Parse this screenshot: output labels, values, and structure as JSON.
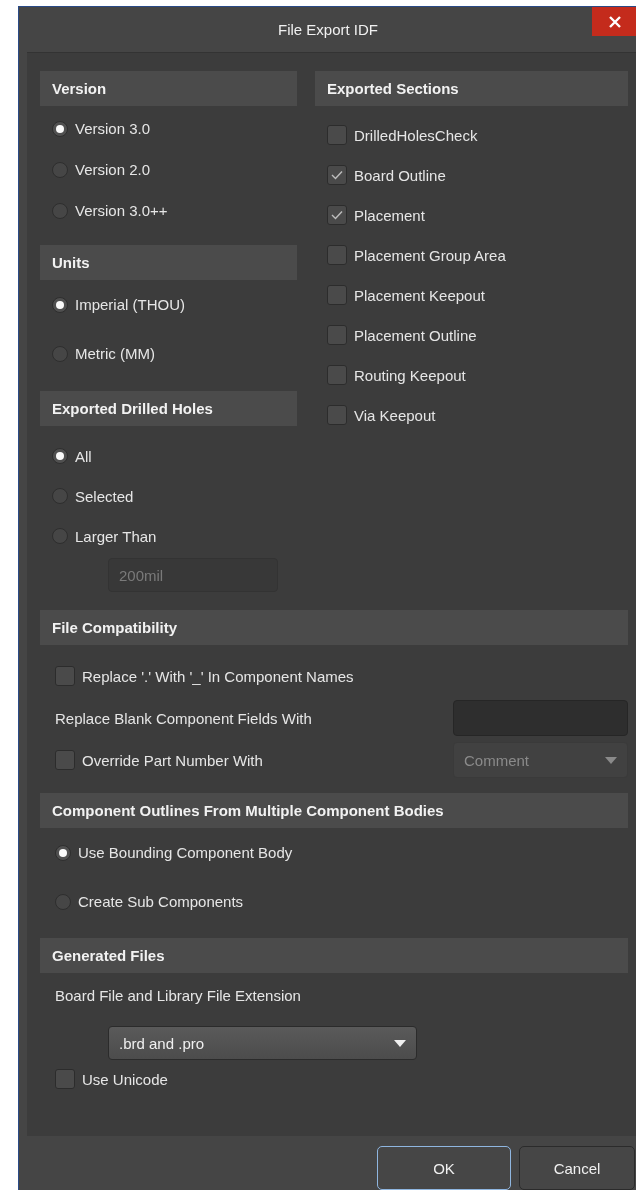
{
  "window": {
    "title": "File Export IDF"
  },
  "version": {
    "title": "Version",
    "options": [
      {
        "label": "Version 3.0",
        "selected": true
      },
      {
        "label": "Version 2.0",
        "selected": false
      },
      {
        "label": "Version 3.0++",
        "selected": false
      }
    ]
  },
  "units": {
    "title": "Units",
    "options": [
      {
        "label": "Imperial (THOU)",
        "selected": true
      },
      {
        "label": "Metric (MM)",
        "selected": false
      }
    ]
  },
  "drilled_holes": {
    "title": "Exported Drilled Holes",
    "options": [
      {
        "label": "All",
        "selected": true
      },
      {
        "label": "Selected",
        "selected": false
      },
      {
        "label": "Larger Than",
        "selected": false
      }
    ],
    "size_field": {
      "value": "200mil",
      "disabled": true
    }
  },
  "exported_sections": {
    "title": "Exported Sections",
    "items": [
      {
        "label": "DrilledHolesCheck",
        "checked": false
      },
      {
        "label": "Board Outline",
        "checked": true
      },
      {
        "label": "Placement",
        "checked": true
      },
      {
        "label": "Placement Group Area",
        "checked": false
      },
      {
        "label": "Placement Keepout",
        "checked": false
      },
      {
        "label": "Placement Outline",
        "checked": false
      },
      {
        "label": "Routing Keepout",
        "checked": false
      },
      {
        "label": "Via Keepout",
        "checked": false
      }
    ]
  },
  "file_compatibility": {
    "title": "File Compatibility",
    "replace_dot": {
      "label": "Replace '.' With '_' In Component Names",
      "checked": false
    },
    "replace_blank": {
      "label": "Replace Blank Component Fields With"
    },
    "override_part": {
      "label": "Override Part Number With",
      "checked": false,
      "dropdown": {
        "value": "Comment",
        "disabled": true
      }
    }
  },
  "component_outlines": {
    "title": "Component Outlines From Multiple Component Bodies",
    "options": [
      {
        "label": "Use Bounding Component Body",
        "selected": true
      },
      {
        "label": "Create Sub Components",
        "selected": false
      }
    ]
  },
  "generated_files": {
    "title": "Generated Files",
    "extension_label": "Board File and Library File Extension",
    "extension_dropdown": {
      "value": ".brd and .pro",
      "disabled": false
    },
    "use_unicode": {
      "label": "Use Unicode",
      "checked": false
    }
  },
  "buttons": [
    {
      "label": "OK",
      "default": true
    },
    {
      "label": "Cancel",
      "default": false
    }
  ]
}
